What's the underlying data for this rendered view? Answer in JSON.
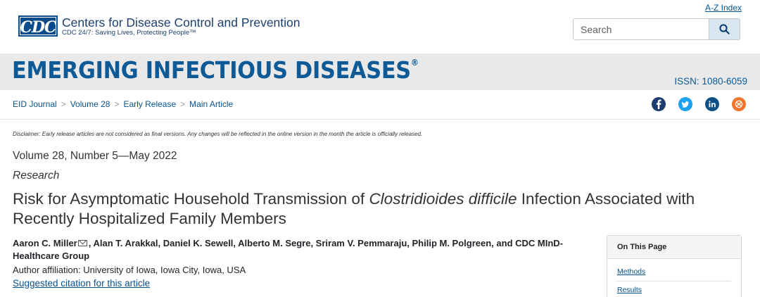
{
  "header": {
    "logo_text": "CDC",
    "org_name": "Centers for Disease Control and Prevention",
    "tagline": "CDC 24/7: Saving Lives, Protecting People™",
    "az_index": "A-Z Index",
    "search": {
      "placeholder": "Search",
      "value": ""
    }
  },
  "banner": {
    "journal_title": "EMERGING INFECTIOUS DISEASES",
    "registered_mark": "®",
    "issn": "ISSN: 1080-6059"
  },
  "breadcrumb": {
    "items": [
      "EID Journal",
      "Volume 28",
      "Early Release",
      "Main Article"
    ],
    "separator": ">"
  },
  "social": {
    "icons": [
      "facebook-icon",
      "twitter-icon",
      "linkedin-icon",
      "syndicate-icon"
    ],
    "colors": {
      "facebook": "#1d3d6e",
      "twitter": "#1da1f2",
      "linkedin": "#0e4f86",
      "syndicate": "#f0762c"
    }
  },
  "article": {
    "disclaimer": "Disclaimer: Early release articles are not considered as final versions. Any changes will be reflected in the online version in the month the article is officially released.",
    "volume": "Volume 28, Number 5—May 2022",
    "type": "Research",
    "title_before": "Risk for Asymptomatic Household Transmission of ",
    "title_italic": "Clostridioides difficile",
    "title_after": " Infection Associated with Recently Hospitalized Family Members",
    "first_author": "Aaron C. Miller",
    "other_authors": ", Alan T. Arakkal, Daniel K. Sewell, Alberto M. Segre, Sriram V. Pemmaraju, Philip M. Polgreen, and CDC MInD-Healthcare Group",
    "affiliation": "Author affiliation: University of Iowa, Iowa City, Iowa, USA",
    "citation_link": "Suggested citation for this article"
  },
  "on_this_page": {
    "heading": "On This Page",
    "links": [
      "Methods",
      "Results"
    ]
  },
  "colors": {
    "brand_blue": "#0e5a96",
    "link_blue": "#075290",
    "banner_bg": "#e9e9e9"
  }
}
